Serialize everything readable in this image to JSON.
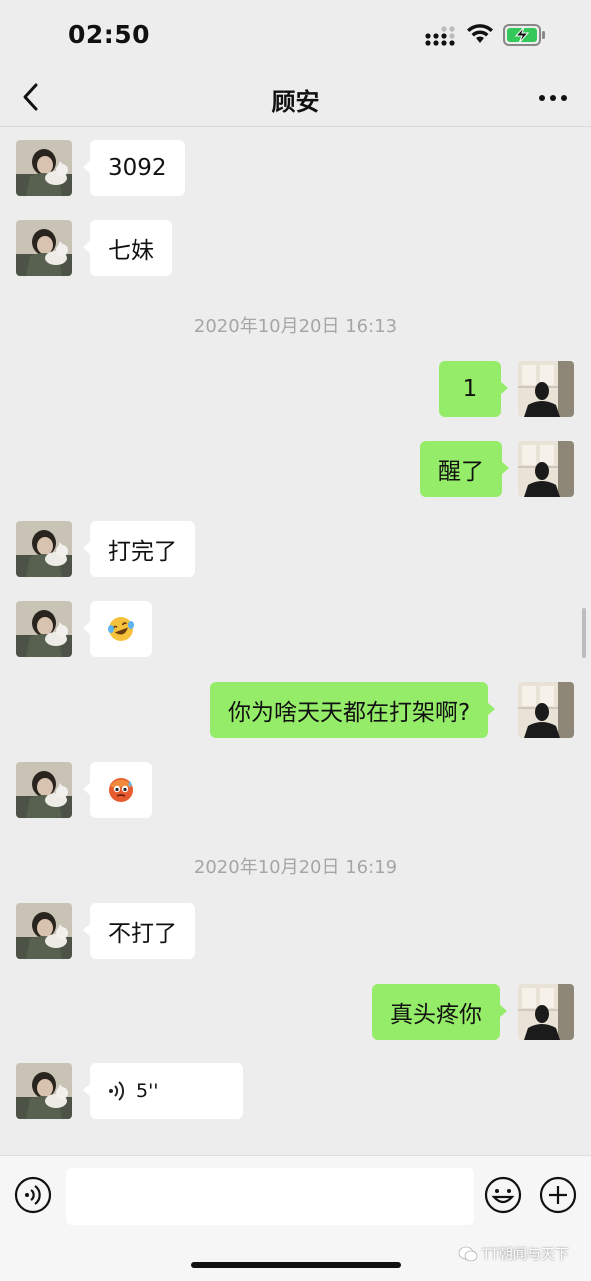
{
  "status_bar": {
    "time": "02:50"
  },
  "header": {
    "title": "顾安",
    "back_icon": "chevron-left-icon",
    "more_icon": "more-dots-icon"
  },
  "messages": [
    {
      "side": "left",
      "text": "3092"
    },
    {
      "side": "left",
      "text": "七妹"
    },
    {
      "timestamp": "2020年10月20日 16:13"
    },
    {
      "side": "right",
      "text": "1"
    },
    {
      "side": "right",
      "text": "醒了"
    },
    {
      "side": "left",
      "text": "打完了"
    },
    {
      "side": "left",
      "emoji": "laughing-crying-face"
    },
    {
      "side": "right",
      "text": "你为啥天天都在打架啊?"
    },
    {
      "side": "left",
      "emoji": "sweating-pleading-face"
    },
    {
      "timestamp": "2020年10月20日 16:19"
    },
    {
      "side": "left",
      "text": "不打了"
    },
    {
      "side": "right",
      "text": "真头疼你"
    },
    {
      "side": "left",
      "voice_duration": "5''"
    }
  ],
  "input_bar": {
    "value": "",
    "placeholder": ""
  },
  "watermark": "TT朝闻与天下",
  "colors": {
    "background": "#ededed",
    "my_bubble": "#95ec69",
    "their_bubble": "#ffffff"
  }
}
